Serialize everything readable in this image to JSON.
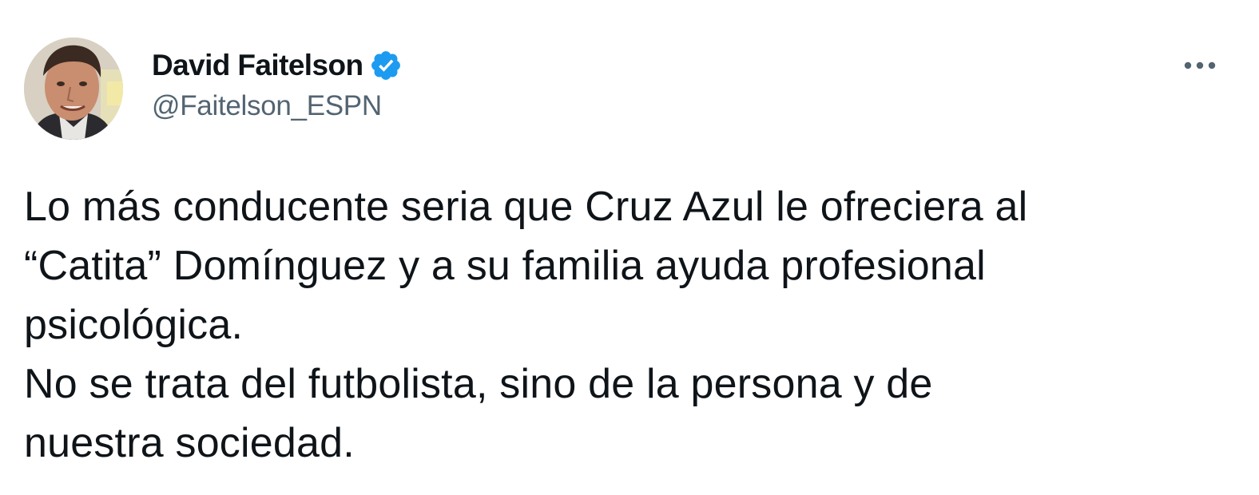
{
  "tweet": {
    "author": {
      "display_name": "David Faitelson",
      "handle": "@Faitelson_ESPN",
      "verified": true,
      "avatar_icon": "person-photo"
    },
    "more_icon": "more-horizontal-icon",
    "text_lines": [
      "Lo más conducente seria que Cruz Azul le ofreciera al",
      "“Catita” Domínguez y a su familia ayuda profesional",
      "psicológica.",
      "No se trata del futbolista, sino de la persona y de",
      "nuestra sociedad."
    ]
  },
  "colors": {
    "verified_blue": "#1d9bf0",
    "text_primary": "#0f1419",
    "text_secondary": "#536471",
    "background": "#ffffff"
  }
}
